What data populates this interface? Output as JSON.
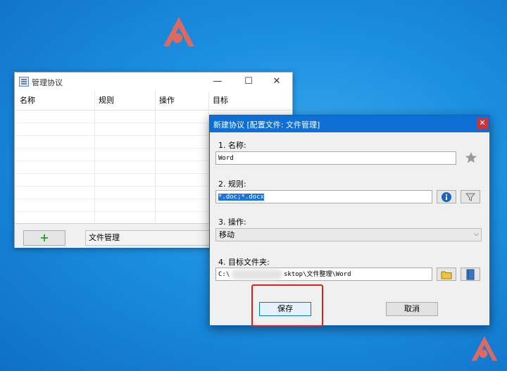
{
  "main_window": {
    "title": "管理协议",
    "controls": {
      "minimize": "—",
      "maximize": "☐",
      "close": "✕"
    },
    "columns": [
      "名称",
      "规则",
      "操作",
      "目标"
    ],
    "add_button": "+",
    "config_select": "文件管理"
  },
  "dialog": {
    "title": "新建协议 [配置文件: 文件管理]",
    "close": "✕",
    "name": {
      "label": "1. 名称:",
      "value": "Word"
    },
    "rule": {
      "label": "2. 规则:",
      "value": "*.doc;*.docx"
    },
    "action": {
      "label": "3. 操作:",
      "value": "移动"
    },
    "target": {
      "label": "4. 目标文件夹:",
      "value_prefix": "C:\\",
      "value_suffix": "sktop\\文件整理\\Word"
    },
    "save_button": "保存",
    "cancel_button": "取消"
  },
  "colors": {
    "accent": "#0d6fd4",
    "highlight": "#e0201f"
  }
}
